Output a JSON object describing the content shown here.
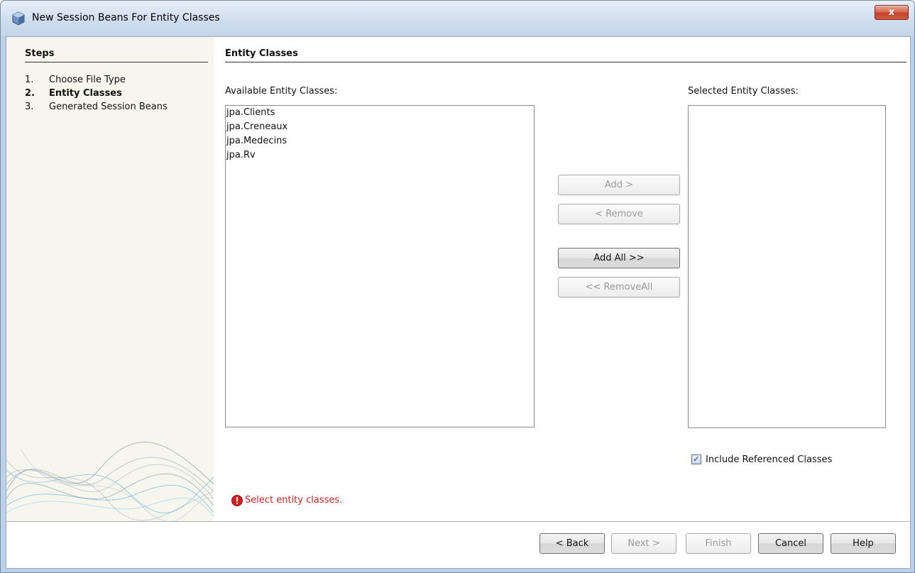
{
  "window": {
    "title": "New Session Beans For Entity Classes",
    "close_label": "x"
  },
  "steps": {
    "heading": "Steps",
    "items": [
      {
        "num": "1.",
        "label": "Choose File Type"
      },
      {
        "num": "2.",
        "label": "Entity Classes",
        "current": true
      },
      {
        "num": "3.",
        "label": "Generated Session Beans"
      }
    ]
  },
  "main": {
    "title": "Entity Classes",
    "available_label": "Available Entity Classes:",
    "available_items": [
      "jpa.Clients",
      "jpa.Creneaux",
      "jpa.Medecins",
      "jpa.Rv"
    ],
    "selected_label": "Selected Entity Classes:",
    "selected_items": [],
    "buttons": {
      "add": "Add >",
      "remove": "< Remove",
      "add_all": "Add All >>",
      "remove_all": "<< RemoveAll"
    },
    "include_referenced": {
      "label": "Include Referenced Classes",
      "checked": true
    },
    "error_message": "Select entity classes."
  },
  "footer": {
    "back": "< Back",
    "next": "Next >",
    "finish": "Finish",
    "cancel": "Cancel",
    "help": "Help"
  },
  "colors": {
    "error": "#d42020",
    "title_bar": "#c9d9ec",
    "close_button": "#c7412a"
  }
}
